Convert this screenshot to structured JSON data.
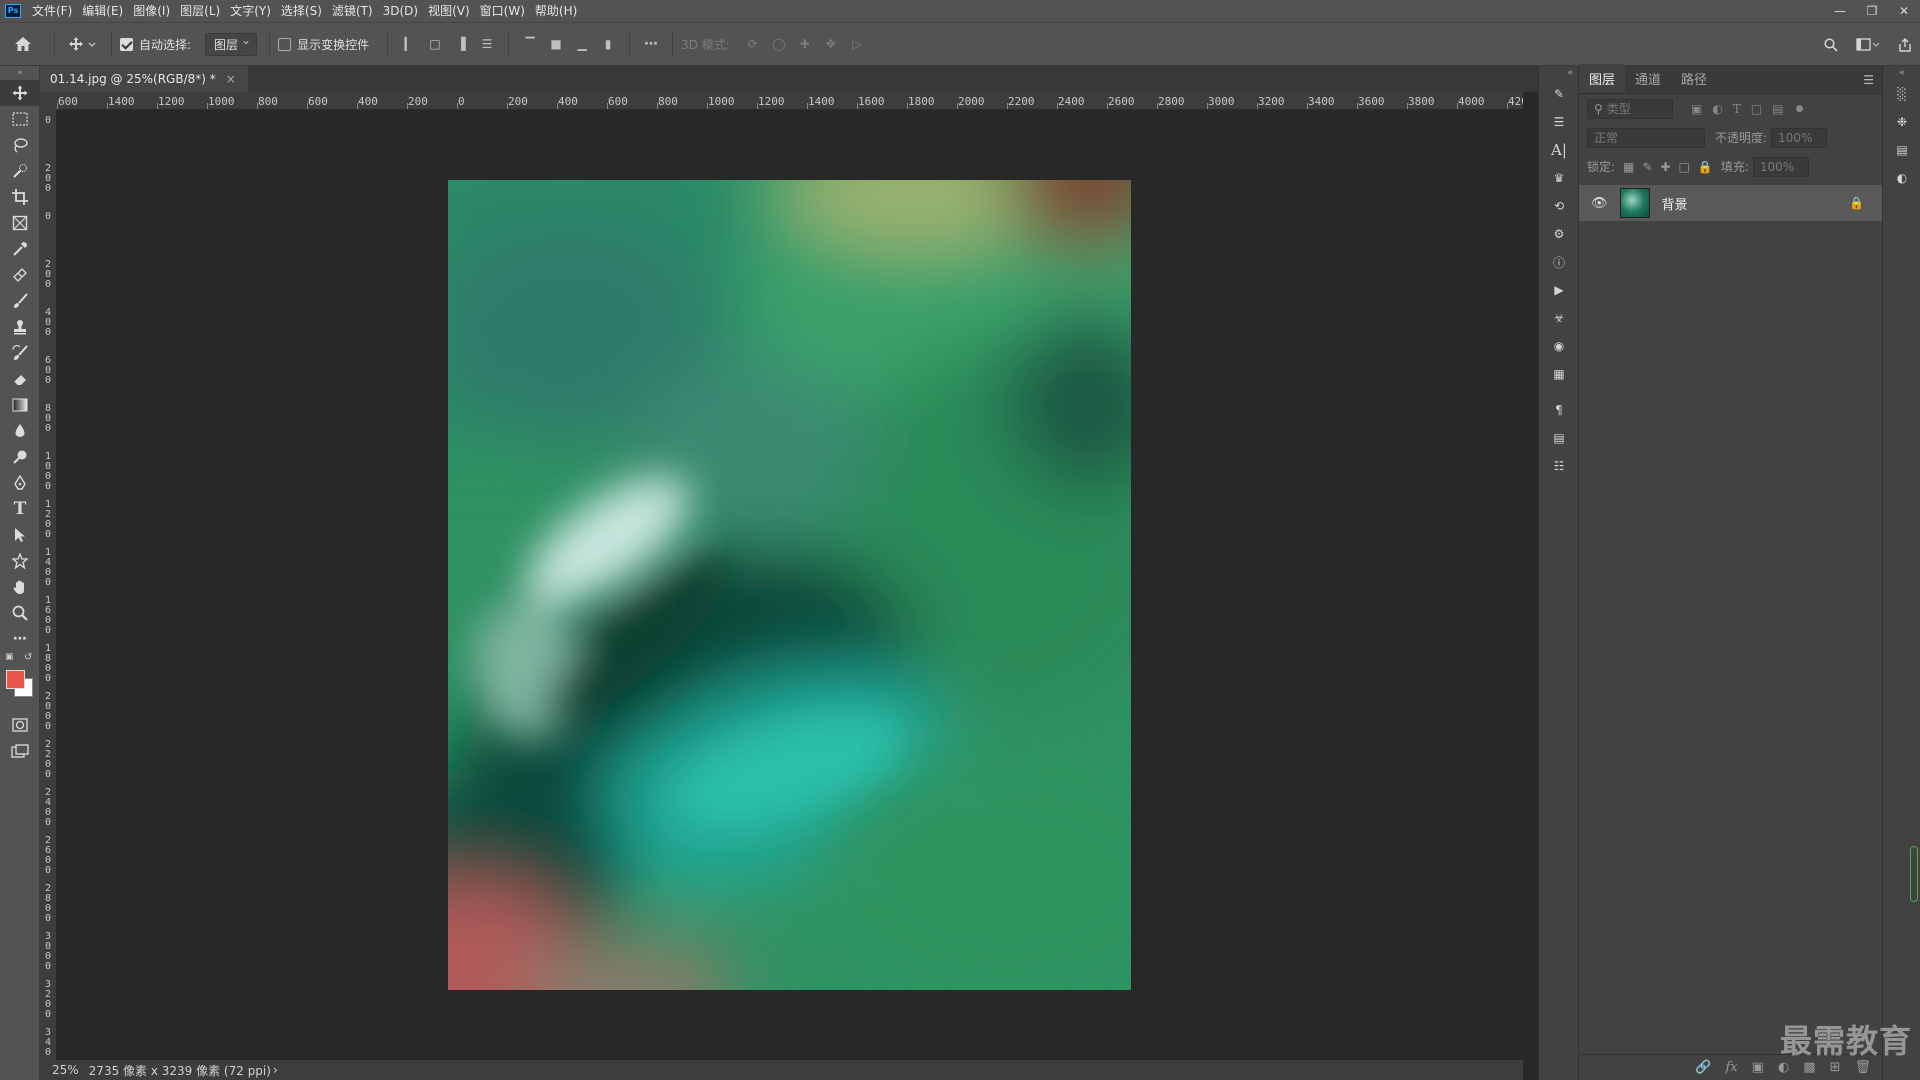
{
  "menu": {
    "logo": "Ps",
    "items": [
      "文件(F)",
      "编辑(E)",
      "图像(I)",
      "图层(L)",
      "文字(Y)",
      "选择(S)",
      "滤镜(T)",
      "3D(D)",
      "视图(V)",
      "窗口(W)",
      "帮助(H)"
    ]
  },
  "options": {
    "auto_select_label": "自动选择:",
    "auto_select_value": "图层",
    "show_transform_label": "显示变换控件",
    "mode_3d_label": "3D 模式:"
  },
  "document": {
    "tab_title": "01.14.jpg @ 25%(RGB/8*) *",
    "tab_close": "×"
  },
  "ruler_h": [
    "600",
    "1400",
    "1200",
    "1000",
    "800",
    "600",
    "400",
    "200",
    "0",
    "200",
    "400",
    "600",
    "800",
    "1000",
    "1200",
    "1400",
    "1600",
    "1800",
    "2000",
    "2200",
    "2400",
    "2600",
    "2800",
    "3000",
    "3200",
    "3400",
    "3600",
    "3800",
    "4000",
    "420"
  ],
  "ruler_v": [
    "0",
    "2 0 0",
    "0",
    "2 0 0",
    "4 0 0",
    "6 0 0",
    "8 0 0",
    "1 0 0 0",
    "1 2 0 0",
    "1 4 0 0",
    "1 6 0 0",
    "1 8 0 0",
    "2 0 0 0",
    "2 2 0 0",
    "2 4 0 0",
    "2 6 0 0",
    "2 8 0 0",
    "3 0 0 0",
    "3 2 0 0",
    "3 4 0"
  ],
  "status": {
    "zoom": "25%",
    "info": "2735 像素 x 3239 像素 (72 ppi)",
    "arrow": "›"
  },
  "layers_panel": {
    "tabs": [
      "图层",
      "通道",
      "路径"
    ],
    "filter_label": "类型",
    "blend_mode": "正常",
    "opacity_label": "不透明度:",
    "opacity_value": "100%",
    "lock_label": "锁定:",
    "fill_label": "填充:",
    "fill_value": "100%",
    "layers": [
      {
        "name": "背景"
      }
    ]
  },
  "watermark": "最需教育",
  "colors": {
    "foreground": "#e8574a",
    "background": "#ffffff"
  }
}
